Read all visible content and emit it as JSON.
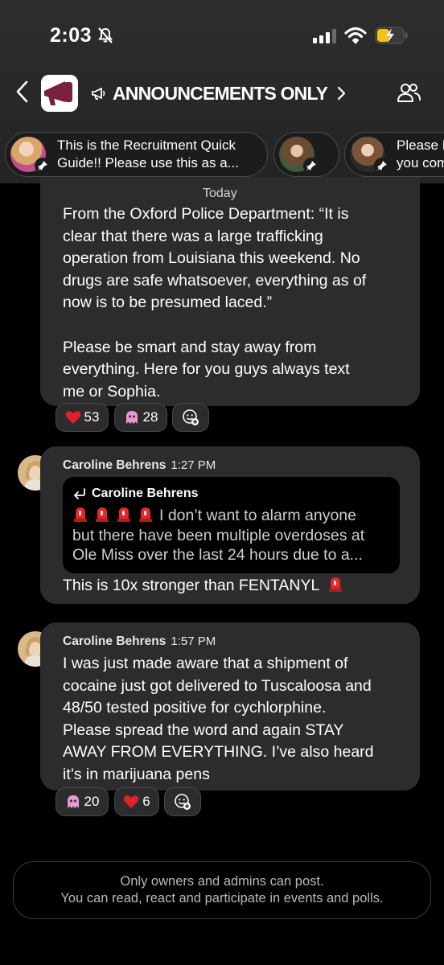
{
  "status_bar": {
    "time": "2:03"
  },
  "header": {
    "title": "ANNOUNCEMENTS ONLY"
  },
  "pinned": [
    {
      "text_line1": "This is the Recruitment Quick",
      "text_line2": "Guide!! Please use this as a..."
    },
    {
      "text_line1": "",
      "text_line2": ""
    },
    {
      "text_line1": "Please E",
      "text_line2": "you com"
    }
  ],
  "date_label": "Today",
  "messages": [
    {
      "lines": [
        "From the Oxford Police Department: “It is",
        "clear that there was a large trafficking",
        "operation from Louisiana this weekend. No",
        "drugs are safe whatsoever, everything as of",
        "now is to be presumed laced.”",
        "",
        "Please be smart and stay away from",
        "everything. Here for you guys always text",
        "me or Sophia."
      ],
      "reactions": [
        {
          "icon": "heart",
          "count": "53"
        },
        {
          "icon": "ghost",
          "count": "28"
        }
      ]
    },
    {
      "sender": "Caroline Behrens",
      "time": "1:27 PM",
      "quote": {
        "sender": "Caroline Behrens",
        "line1": "I don’t want to alarm anyone",
        "line2": "but there have been multiple overdoses at",
        "line3": "Ole Miss over the last 24 hours due to a..."
      },
      "text": "This is 10x stronger than FENTANYL"
    },
    {
      "sender": "Caroline Behrens",
      "time": "1:57 PM",
      "lines": [
        "I was just made aware that a shipment of",
        "cocaine just got delivered to Tuscaloosa and",
        "48/50 tested positive for cychlorphine.",
        "Please spread the word and again STAY",
        "AWAY FROM EVERYTHING. I’ve also heard",
        "it’s in marijuana pens"
      ],
      "reactions": [
        {
          "icon": "ghost",
          "count": "20"
        },
        {
          "icon": "heart",
          "count": "6"
        }
      ]
    }
  ],
  "footer": {
    "line1": "Only owners and admins can post.",
    "line2": "You can read, react and participate in events and polls."
  },
  "colors": {
    "background": "#000000",
    "bubble": "#2c2c2e",
    "brand": "#7a1f3d",
    "heart": "#e0202a",
    "siren": "#e02a2a"
  }
}
